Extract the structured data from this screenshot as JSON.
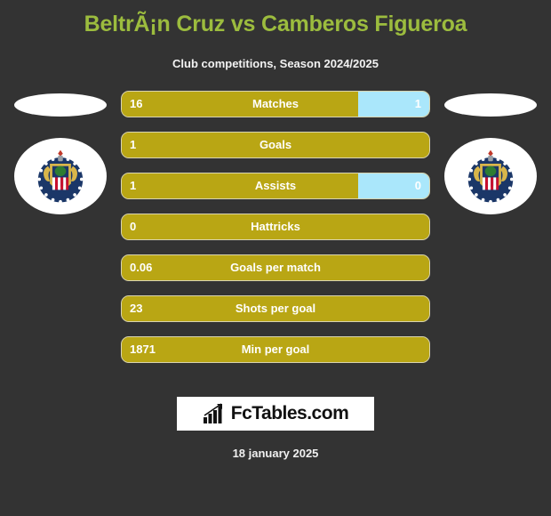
{
  "header": {
    "title": "BeltrÃ¡n Cruz vs Camberos Figueroa",
    "subtitle": "Club competitions, Season 2024/2025"
  },
  "colors": {
    "background": "#333333",
    "title_green": "#9CBC3E",
    "home_gold": "#B9A614",
    "away_blue": "#AAE7FB",
    "text_white": "#FFFFFF",
    "bar_border": "#D9D4B0"
  },
  "crests": {
    "left": {
      "name": "club-crest-left",
      "alt": "Chivas Guadalajara crest"
    },
    "right": {
      "name": "club-crest-right",
      "alt": "Chivas Guadalajara crest"
    }
  },
  "chart_data": {
    "type": "bar",
    "title": "BeltrÃ¡n Cruz vs Camberos Figueroa",
    "subtitle": "Club competitions, Season 2024/2025",
    "orientation": "horizontal-diverging",
    "series": [
      {
        "name": "BeltrÃ¡n Cruz",
        "color": "#B9A614"
      },
      {
        "name": "Camberos Figueroa",
        "color": "#AAE7FB"
      }
    ],
    "categories": [
      "Matches",
      "Goals",
      "Assists",
      "Hattricks",
      "Goals per match",
      "Shots per goal",
      "Min per goal"
    ],
    "rows": [
      {
        "label": "Matches",
        "home": "16",
        "away": "1",
        "home_pct": 77,
        "away_pct": 23,
        "has_away": true
      },
      {
        "label": "Goals",
        "home": "1",
        "away": "",
        "home_pct": 100,
        "away_pct": 0,
        "has_away": false
      },
      {
        "label": "Assists",
        "home": "1",
        "away": "0",
        "home_pct": 77,
        "away_pct": 23,
        "has_away": true
      },
      {
        "label": "Hattricks",
        "home": "0",
        "away": "",
        "home_pct": 100,
        "away_pct": 0,
        "has_away": false
      },
      {
        "label": "Goals per match",
        "home": "0.06",
        "away": "",
        "home_pct": 100,
        "away_pct": 0,
        "has_away": false
      },
      {
        "label": "Shots per goal",
        "home": "23",
        "away": "",
        "home_pct": 100,
        "away_pct": 0,
        "has_away": false
      },
      {
        "label": "Min per goal",
        "home": "1871",
        "away": "",
        "home_pct": 100,
        "away_pct": 0,
        "has_away": false
      }
    ]
  },
  "logo": {
    "text": "FcTables.com",
    "icon": "bar-chart-icon"
  },
  "footer": {
    "date": "18 january 2025"
  }
}
